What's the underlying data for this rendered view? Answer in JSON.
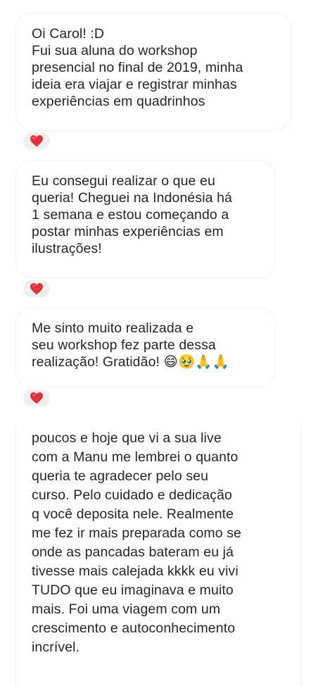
{
  "messages": [
    {
      "text": "Oi Carol! :D\nFui sua aluna do workshop\npresencial no final de 2019, minha\nideia era viajar e registrar minhas\nexperiências em quadrinhos",
      "reaction": "heart-emoji"
    },
    {
      "text": "Eu consegui realizar o que eu\nqueria! Cheguei na Indonésia há\n1 semana e estou começando a\npostar minhas experiências em\nilustrações!",
      "reaction": "heart-emoji"
    },
    {
      "text": "Me sinto muito realizada e\nseu workshop fez parte dessa\nrealização! Gratidão! 😄🥹🙏🙏",
      "reaction": "heart-emoji"
    },
    {
      "text": "poucos e hoje que vi a sua live\ncom a Manu me lembrei o quanto\nqueria te agradecer pelo seu\ncurso. Pelo cuidado e dedicação\nq você deposita nele. Realmente\nme fez ir mais preparada como se\nonde as pancadas bateram eu já\ntivesse mais calejada kkkk eu vivi\nTUDO que eu imaginava e muito\nmais. Foi uma viagem com um\ncrescimento e autoconhecimento\nincrível."
    }
  ],
  "colors": {
    "bubble_border": "#efefef",
    "text": "#262626",
    "reaction_bg": "#efefef",
    "heart": "#ed4956"
  }
}
